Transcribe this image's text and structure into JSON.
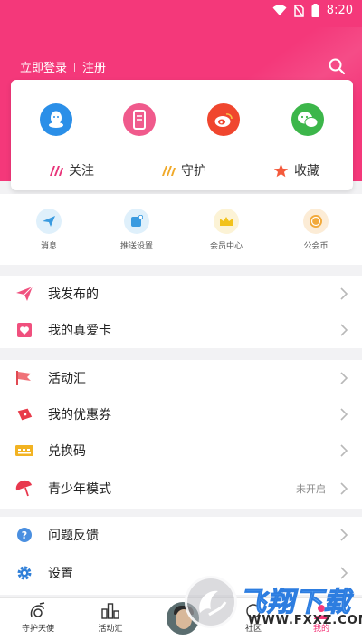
{
  "status_bar": {
    "time": "8:20"
  },
  "header": {
    "login": "立即登录",
    "register": "注册",
    "colors": {
      "primary": "#f4387a"
    }
  },
  "card": {
    "socials": [
      {
        "name": "qq-icon",
        "color": "#2b8fe8"
      },
      {
        "name": "phone-icon",
        "color": "#f05a8c"
      },
      {
        "name": "weibo-icon",
        "color": "#f0462e"
      },
      {
        "name": "wechat-icon",
        "color": "#3cb64a"
      }
    ],
    "tabs": [
      {
        "label": "关注",
        "icon": "follow-icon"
      },
      {
        "label": "守护",
        "icon": "guard-icon"
      },
      {
        "label": "收藏",
        "icon": "star-icon"
      }
    ]
  },
  "quick": [
    {
      "label": "消息",
      "icon": "message-icon"
    },
    {
      "label": "推送设置",
      "icon": "push-settings-icon"
    },
    {
      "label": "会员中心",
      "icon": "crown-icon"
    },
    {
      "label": "公会币",
      "icon": "coin-icon"
    }
  ],
  "menu": {
    "group1": [
      {
        "label": "我发布的",
        "icon": "send-icon"
      },
      {
        "label": "我的真爱卡",
        "icon": "heart-card-icon"
      }
    ],
    "group2": [
      {
        "label": "活动汇",
        "icon": "flag-icon"
      },
      {
        "label": "我的优惠券",
        "icon": "coupon-icon"
      },
      {
        "label": "兑换码",
        "icon": "code-icon"
      },
      {
        "label": "青少年模式",
        "icon": "umbrella-icon",
        "value": "未开启"
      }
    ],
    "group3": [
      {
        "label": "问题反馈",
        "icon": "question-icon"
      },
      {
        "label": "设置",
        "icon": "gear-icon"
      }
    ]
  },
  "tabbar": {
    "tabs": [
      {
        "label": "守护天使",
        "icon": "angel-icon"
      },
      {
        "label": "活动汇",
        "icon": "activity-icon"
      },
      {
        "label": "社区",
        "icon": "community-icon"
      },
      {
        "label": "我的",
        "icon": "mine-icon"
      }
    ]
  },
  "watermark": {
    "brand": "飞翔下载",
    "url": "WWW.FXXZ.COM"
  }
}
